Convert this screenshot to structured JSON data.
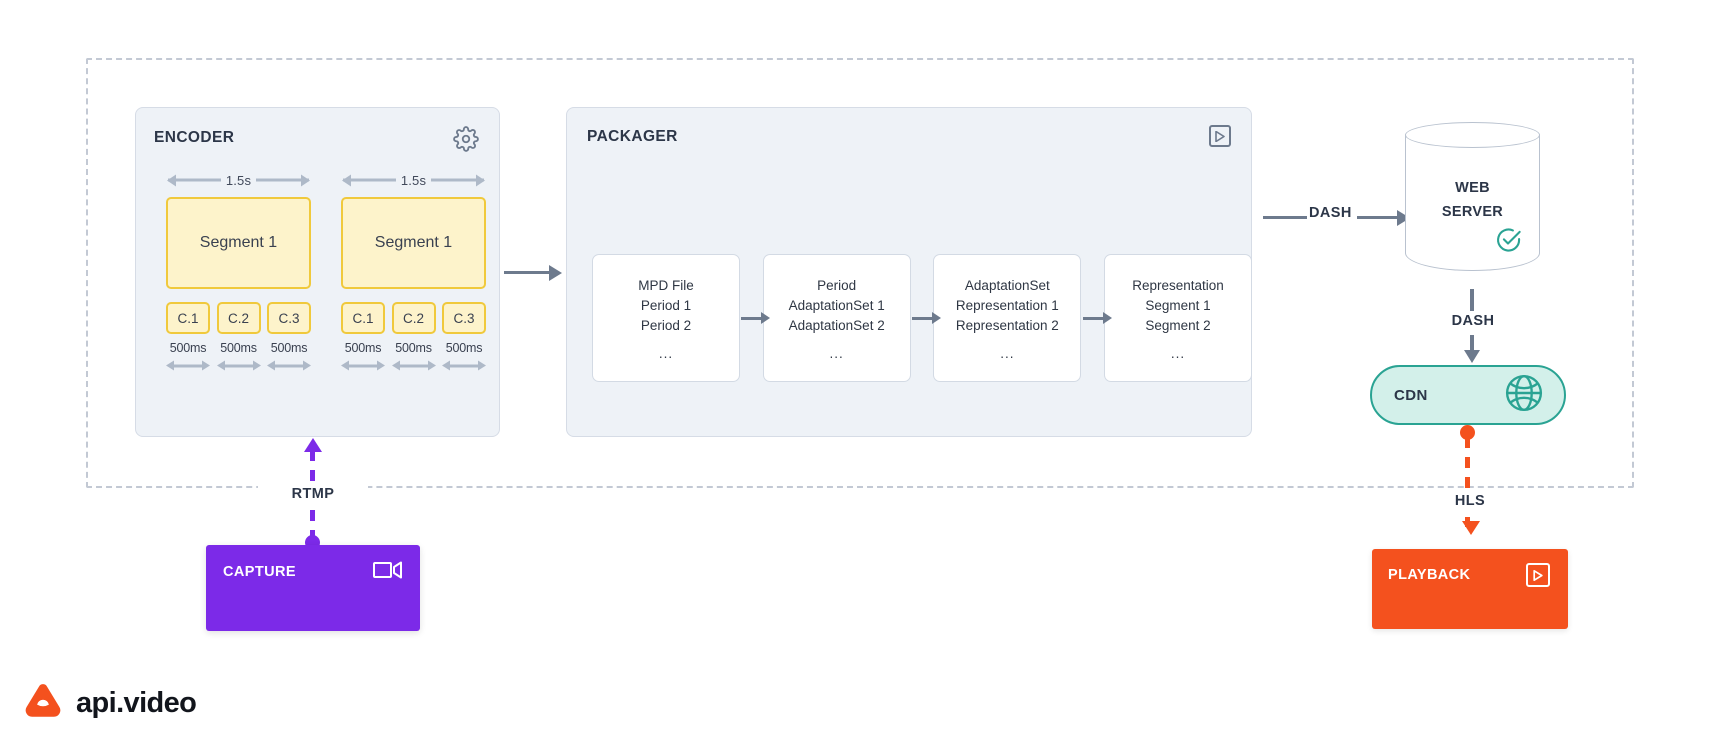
{
  "brand": {
    "name": "api.video",
    "logo_icon": "api-video-triangle-logo",
    "logo_color": "#F4511E"
  },
  "colors": {
    "panel_bg": "#EEF2F7",
    "panel_border": "#D6DCE6",
    "segment_fill": "#FDF3CB",
    "segment_border": "#F0C93C",
    "arrow_gray": "#6D7A8D",
    "dim_arrow_gray": "#AEB9C8",
    "cdn_fill": "#D3F0EA",
    "cdn_border": "#2AA393",
    "capture_purple": "#7C2AE8",
    "playback_orange": "#F4511E",
    "text_dark": "#2C3648",
    "dashed_boundary": "#C3C9D4"
  },
  "encoder": {
    "title": "ENCODER",
    "settings_icon": "gear-icon",
    "segment_groups": [
      {
        "duration_label": "1.5s",
        "segment_label": "Segment 1",
        "chunks": [
          {
            "label": "C.1",
            "duration": "500ms"
          },
          {
            "label": "C.2",
            "duration": "500ms"
          },
          {
            "label": "C.3",
            "duration": "500ms"
          }
        ]
      },
      {
        "duration_label": "1.5s",
        "segment_label": "Segment 1",
        "chunks": [
          {
            "label": "C.1",
            "duration": "500ms"
          },
          {
            "label": "C.2",
            "duration": "500ms"
          },
          {
            "label": "C.3",
            "duration": "500ms"
          }
        ]
      }
    ]
  },
  "packager": {
    "title": "PACKAGER",
    "play_icon": "play-icon",
    "cards": [
      {
        "lines": [
          "MPD File",
          "Period 1",
          "Period 2"
        ],
        "ellipsis": "..."
      },
      {
        "lines": [
          "Period",
          "AdaptationSet 1",
          "AdaptationSet 2"
        ],
        "ellipsis": "..."
      },
      {
        "lines": [
          "AdaptationSet",
          "Representation 1",
          "Representation 2"
        ],
        "ellipsis": "..."
      },
      {
        "lines": [
          "Representation",
          "Segment 1",
          "Segment 2"
        ],
        "ellipsis": "..."
      }
    ]
  },
  "connectors": {
    "encoder_to_packager": {
      "label": "",
      "icon": "arrow-right-icon"
    },
    "packager_to_webserver": {
      "label": "DASH",
      "icon": "arrow-right-icon"
    },
    "webserver_to_cdn": {
      "label": "DASH",
      "icon": "arrow-down-icon"
    },
    "cdn_to_playback": {
      "label": "HLS",
      "icon": "arrow-down-dashed-icon"
    },
    "capture_to_encoder": {
      "label": "RTMP",
      "icon": "arrow-up-dashed-icon"
    }
  },
  "web_server": {
    "line1": "WEB",
    "line2": "SERVER",
    "status_icon": "check-circle-icon"
  },
  "cdn": {
    "label": "CDN",
    "icon": "globe-icon"
  },
  "playback": {
    "label": "PLAYBACK",
    "icon": "play-icon"
  },
  "capture": {
    "label": "CAPTURE",
    "icon": "video-camera-icon"
  }
}
